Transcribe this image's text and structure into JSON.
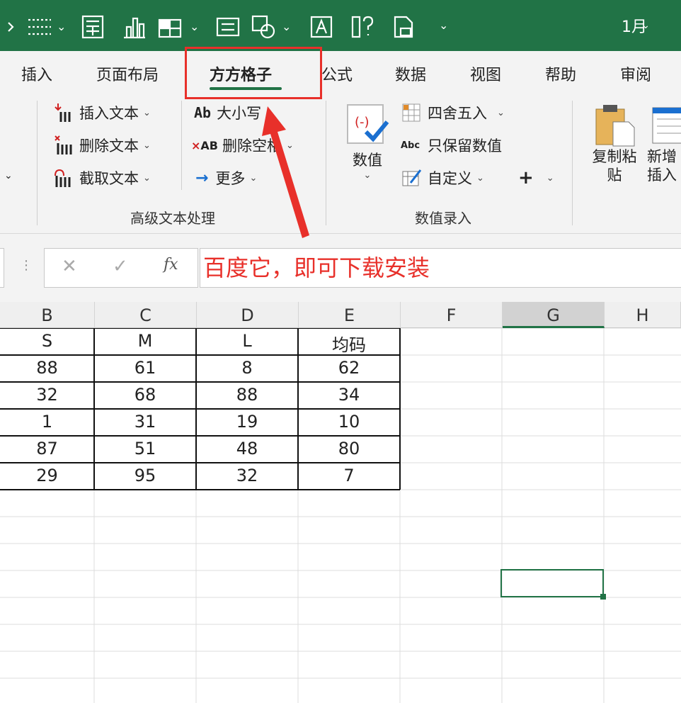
{
  "titlebar": {
    "month": "1月"
  },
  "tabs": [
    {
      "label": "插入"
    },
    {
      "label": "页面布局"
    },
    {
      "label": "方方格子"
    },
    {
      "label": "公式"
    },
    {
      "label": "数据"
    },
    {
      "label": "视图"
    },
    {
      "label": "帮助"
    },
    {
      "label": "审阅"
    }
  ],
  "ribbon": {
    "text_group": {
      "label": "高级文本处理",
      "insert_text": "插入文本",
      "delete_text": "删除文本",
      "extract_text": "截取文本",
      "case": "大小写",
      "delete_space": "删除空格",
      "more": "更多"
    },
    "value_group": {
      "label": "数值录入",
      "value_btn": "数值",
      "round": "四舍五入",
      "keep_value": "只保留数值",
      "custom": "自定义",
      "plus": "+"
    },
    "copy_paste": "复制粘贴",
    "new_insert": "新增插入"
  },
  "formula_bar": {
    "content": "百度它，即可下载安装"
  },
  "sheet": {
    "columns": [
      "B",
      "C",
      "D",
      "E",
      "F",
      "G",
      "H"
    ],
    "rows": [
      [
        "S",
        "M",
        "L",
        "均码"
      ],
      [
        "88",
        "61",
        "8",
        "62"
      ],
      [
        "32",
        "68",
        "88",
        "34"
      ],
      [
        "1",
        "31",
        "19",
        "10"
      ],
      [
        "87",
        "51",
        "48",
        "80"
      ],
      [
        "29",
        "95",
        "32",
        "7"
      ]
    ]
  },
  "colors": {
    "accent": "#217346",
    "annotation": "#e8302a"
  }
}
